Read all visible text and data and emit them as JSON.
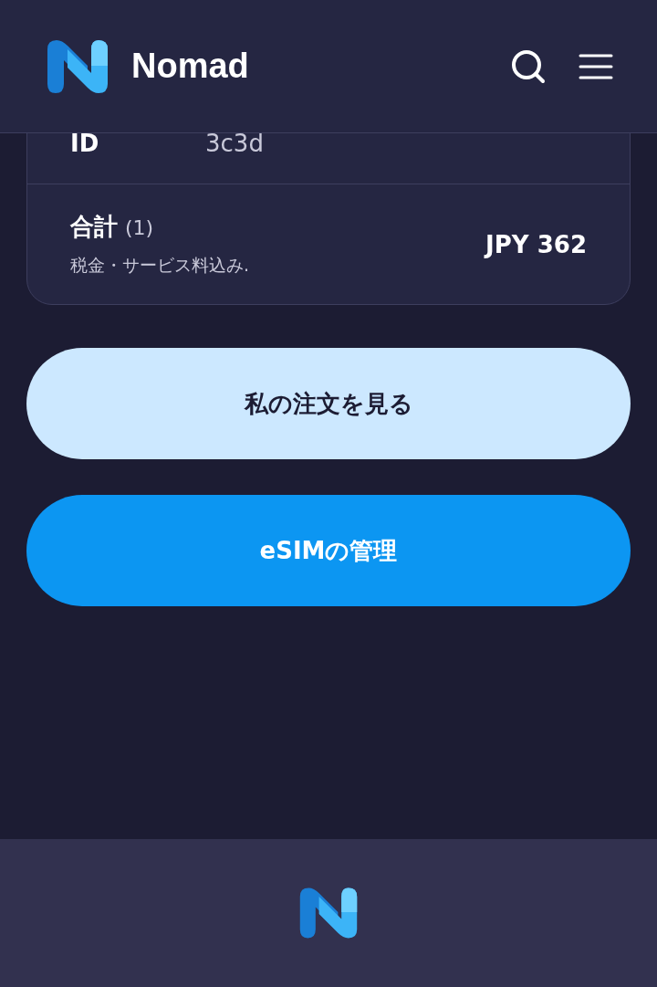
{
  "header": {
    "brand": "Nomad"
  },
  "order_card": {
    "id_row": {
      "label": "ID",
      "value": "3c3d"
    },
    "total": {
      "label": "合計",
      "count": "(1)",
      "note": "税金・サービス料込み.",
      "amount": "JPY 362"
    }
  },
  "buttons": [
    {
      "kind": "secondary",
      "label": "私の注文を見る"
    },
    {
      "kind": "primary",
      "label": "eSIMの管理"
    }
  ]
}
